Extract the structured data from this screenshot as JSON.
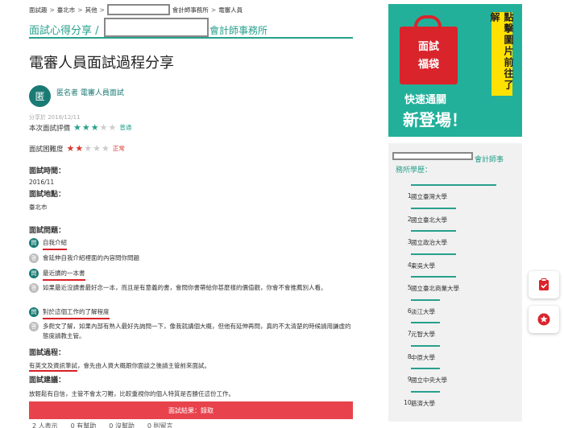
{
  "breadcrumb": {
    "items": [
      "面試趣",
      "臺北市",
      "其他",
      "會計師事務所",
      "電審人員"
    ]
  },
  "header": {
    "label": "面試心得分享 /",
    "company_suffix": "會計師事務所"
  },
  "title": "電審人員面試過程分享",
  "author": {
    "avatar_char": "匿",
    "name": "匿名者 電審人員面試"
  },
  "meta": {
    "shared_on": "分享於 2018/12/11"
  },
  "rating": {
    "label": "本次面試評價",
    "stars": 3,
    "max": 5,
    "tag": "普通"
  },
  "difficulty": {
    "label": "面試困難度",
    "stars": 2,
    "max": 5,
    "tag": "正常"
  },
  "time": {
    "heading": "面試時間：",
    "value": "2016/11"
  },
  "location": {
    "heading": "面試地點：",
    "value": "臺北市"
  },
  "questions": {
    "heading": "面試問題：",
    "q_badge": "問",
    "a_badge": "答",
    "items": [
      {
        "q": "自我介紹",
        "a": "會延伸自我介紹裡面的內容問你問題"
      },
      {
        "q": "最近讀的一本書",
        "a": "如果最近沒讀書最好念一本，而且是有意義的書，會問你書帶給你甚麼樣的價值觀，你會不會推薦別人看。"
      },
      {
        "q": "對於這個工作的了解程度",
        "a": "多爬文了解，如果內部有熟人最好先詢問一下，像我就講個大概，但他有延伸再問，真的不太清楚的時候請用謙虛的態度請教主管。"
      }
    ]
  },
  "process": {
    "heading": "面試過程：",
    "underlined": "有英文及資訊筆試",
    "rest": "，會先由人資大概跟你面談之後請主管前來面試。"
  },
  "advice": {
    "heading": "面試建議：",
    "value": "放輕鬆有自信，主管不會太刁難，比較重視你的個人特質是否勝任這份工作。"
  },
  "result": {
    "label": "面試結果：錄取"
  },
  "actions": {
    "text": "2 人表示　　0 有幫助　　0 沒幫助　　0 則留言"
  },
  "ad": {
    "bag_line1": "面試",
    "bag_line2": "福袋",
    "strip": "點擊圖片前往了解",
    "line1": "快速通關",
    "line2": "新登場！"
  },
  "side": {
    "heading_suffix": "會計師事",
    "heading_line2": "務所學歷：",
    "schools": [
      {
        "n": "1.",
        "name": "國立臺灣大學",
        "bar": 1.0
      },
      {
        "n": "2.",
        "name": "國立臺北大學",
        "bar": 0.53
      },
      {
        "n": "3.",
        "name": "國立政治大學",
        "bar": 0.53
      },
      {
        "n": "4.",
        "name": "東吳大學",
        "bar": 0.53
      },
      {
        "n": "5.",
        "name": "國立臺北商業大學",
        "bar": 0.53
      },
      {
        "n": "6.",
        "name": "淡江大學",
        "bar": 0.34
      },
      {
        "n": "7.",
        "name": "元智大學",
        "bar": 0.34
      },
      {
        "n": "8.",
        "name": "中原大學",
        "bar": 0.34
      },
      {
        "n": "9.",
        "name": "國立中央大學",
        "bar": 0.34
      },
      {
        "n": "10.",
        "name": "慈濟大學",
        "bar": 0.34
      }
    ]
  },
  "floating": {
    "clipboard_icon": "clipboard-check-icon",
    "star_icon": "star-circle-icon"
  },
  "colors": {
    "accent": "#27a08c",
    "red": "#d9362e",
    "ad_bg": "#23b09a"
  }
}
